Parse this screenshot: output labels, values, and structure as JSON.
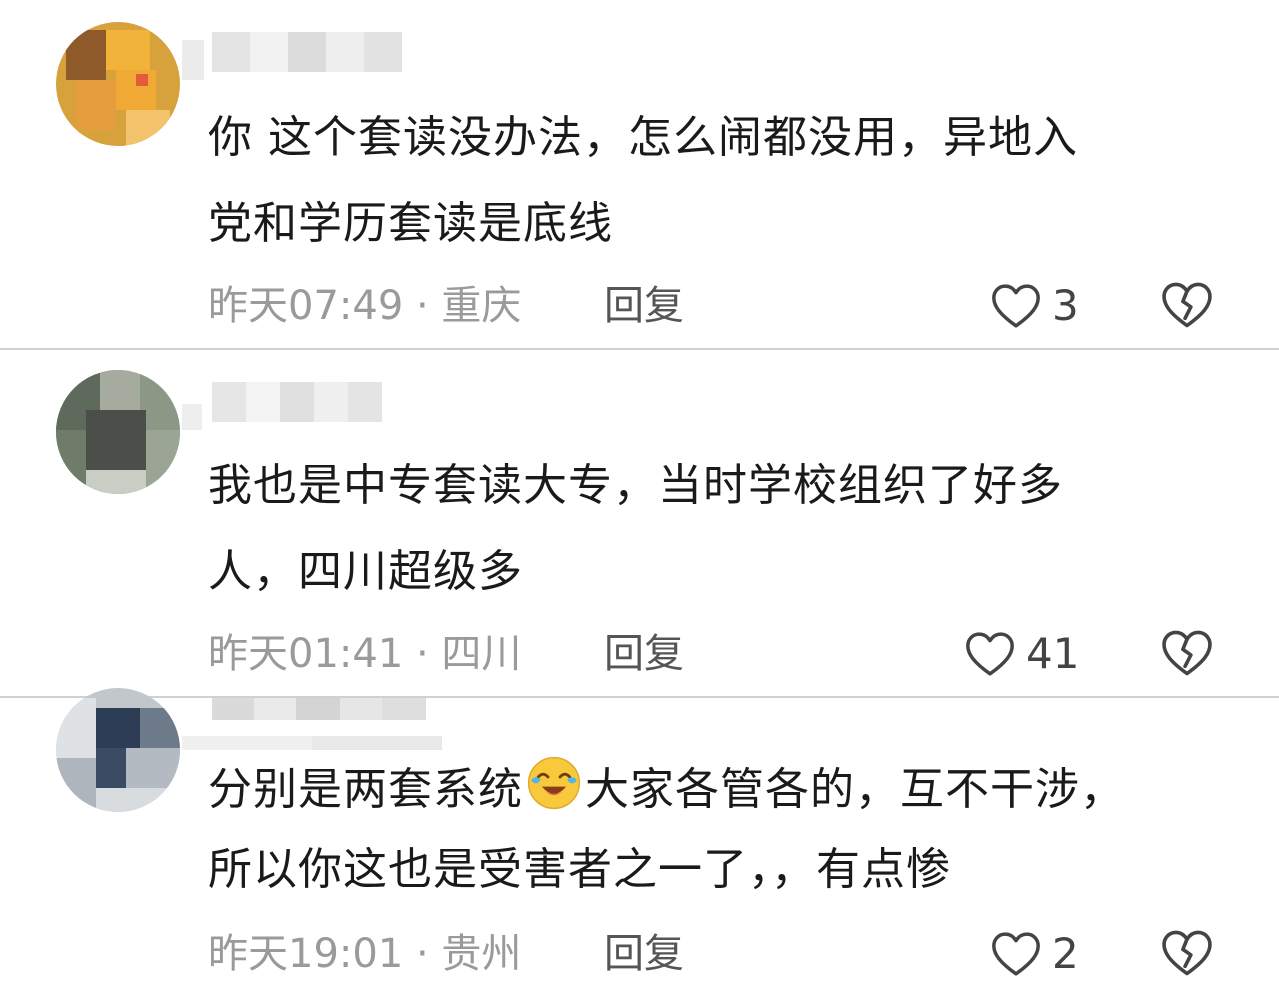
{
  "comments": [
    {
      "line1": "你 这个套读没办法，怎么闹都没用，异地入",
      "line2": "党和学历套读是底线",
      "time": "昨天07:49 · 重庆",
      "reply": "回复",
      "likes": "3",
      "icons": {
        "like": "heart-outline-icon",
        "dislike": "broken-heart-icon"
      }
    },
    {
      "line1": "我也是中专套读大专，当时学校组织了好多",
      "line2": "人，四川超级多",
      "time": "昨天01:41 · 四川",
      "reply": "回复",
      "likes": "41",
      "icons": {
        "like": "heart-outline-icon",
        "dislike": "broken-heart-icon"
      }
    },
    {
      "line1a": "分别是两套系统",
      "emoji": "crying-laughing-emoji",
      "line1b": "大家各管各的，互不干涉，",
      "line2": "所以你这也是受害者之一了，，有点惨",
      "time": "昨天19:01 · 贵州",
      "reply": "回复",
      "likes": "2",
      "icons": {
        "like": "heart-outline-icon",
        "dislike": "broken-heart-icon"
      }
    }
  ],
  "colors": {
    "text": "#1a1a1a",
    "meta": "#9a9a9a",
    "icon": "#444444",
    "divider": "#d0d0d0"
  }
}
